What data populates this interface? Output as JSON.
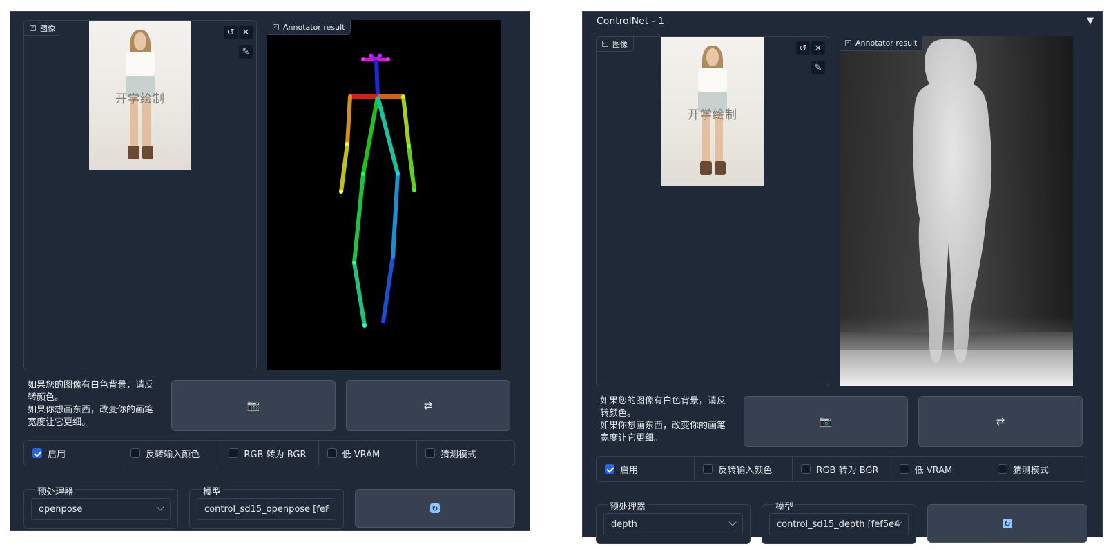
{
  "left_panel": {
    "image_label": "图像",
    "result_label": "Annotator result",
    "hint_lines": [
      "如果您的图像有白色背景，请反",
      "转颜色。",
      "如果你想画东西，改变你的画笔",
      "宽度让它更细。"
    ],
    "watermark": "开学绘制",
    "camera_button": "📷",
    "swap_button": "⇄",
    "checkboxes": [
      {
        "label": "启用",
        "checked": true
      },
      {
        "label": "反转输入颜色",
        "checked": false
      },
      {
        "label": "RGB 转为 BGR",
        "checked": false
      },
      {
        "label": "低 VRAM",
        "checked": false
      },
      {
        "label": "猜测模式",
        "checked": false
      }
    ],
    "preprocessor_label": "预处理器",
    "preprocessor_value": "openpose",
    "model_label": "模型",
    "model_value": "control_sd15_openpose [fef"
  },
  "right_panel": {
    "title": "ControlNet - 1",
    "collapse_glyph": "▼",
    "image_label": "图像",
    "result_label": "Annotator result",
    "hint_lines": [
      "如果您的图像有白色背景，请反",
      "转颜色。",
      "如果你想画东西，改变你的画笔",
      "宽度让它更细。"
    ],
    "watermark": "开学绘制",
    "camera_button": "📷",
    "swap_button": "⇄",
    "checkboxes": [
      {
        "label": "启用",
        "checked": true
      },
      {
        "label": "反转输入颜色",
        "checked": false
      },
      {
        "label": "RGB 转为 BGR",
        "checked": false
      },
      {
        "label": "低 VRAM",
        "checked": false
      },
      {
        "label": "猜测模式",
        "checked": false
      }
    ],
    "preprocessor_label": "预处理器",
    "preprocessor_value": "depth",
    "model_label": "模型",
    "model_value": "control_sd15_depth [fef5e4"
  },
  "icons": {
    "undo": "↺",
    "close": "✕",
    "brush": "✎",
    "refresh": "↻"
  },
  "colors": {
    "panel_bg": "#1f2937",
    "border": "#374151",
    "button_bg": "#374151",
    "checkbox_accent": "#2563eb"
  }
}
